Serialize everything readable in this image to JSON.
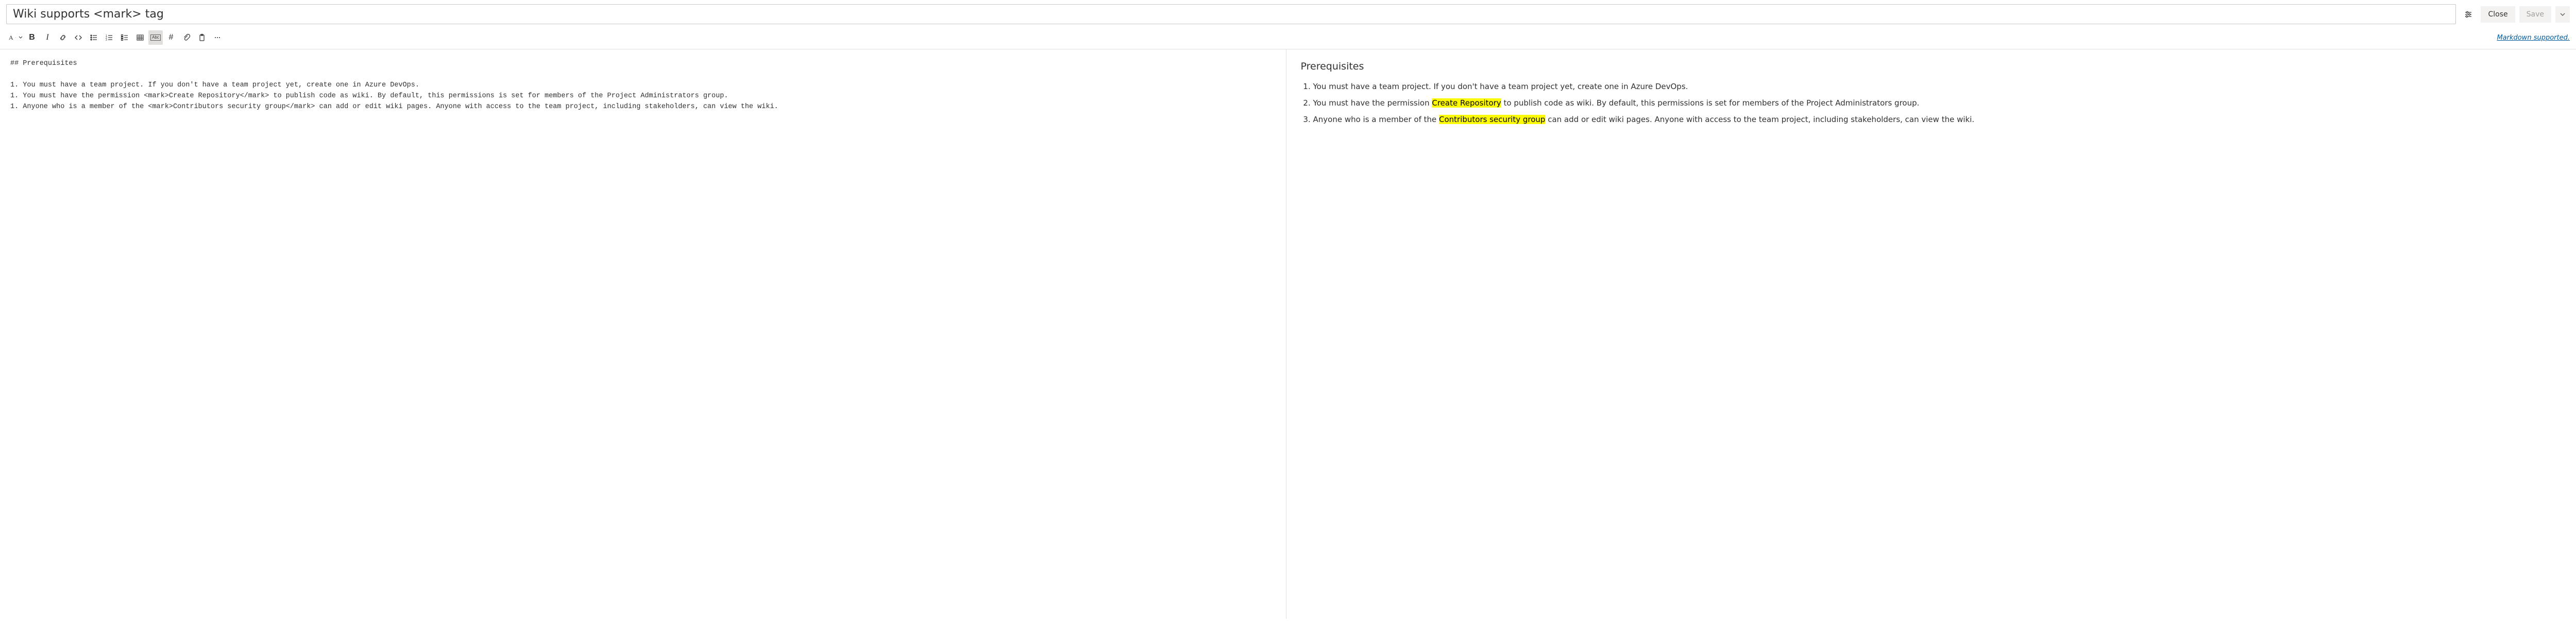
{
  "header": {
    "title_value": "Wiki supports <mark> tag",
    "close_label": "Close",
    "save_label": "Save"
  },
  "toolbar": {
    "markdown_link": "Markdown supported.",
    "abc_label": "Abc",
    "hash_label": "#"
  },
  "editor": {
    "raw": "## Prerequisites\n\n1. You must have a team project. If you don't have a team project yet, create one in Azure DevOps.\n1. You must have the permission <mark>Create Repository</mark> to publish code as wiki. By default, this permissions is set for members of the Project Administrators group.\n1. Anyone who is a member of the <mark>Contributors security group</mark> can add or edit wiki pages. Anyone with access to the team project, including stakeholders, can view the wiki."
  },
  "preview": {
    "heading": "Prerequisites",
    "items": [
      {
        "pre": "You must have a team project. If you don't have a team project yet, create one in Azure DevOps.",
        "mark": "",
        "post": ""
      },
      {
        "pre": "You must have the permission ",
        "mark": "Create Repository",
        "post": " to publish code as wiki. By default, this permissions is set for members of the Project Administrators group."
      },
      {
        "pre": "Anyone who is a member of the ",
        "mark": "Contributors security group",
        "post": " can add or edit wiki pages. Anyone with access to the team project, including stakeholders, can view the wiki."
      }
    ]
  }
}
